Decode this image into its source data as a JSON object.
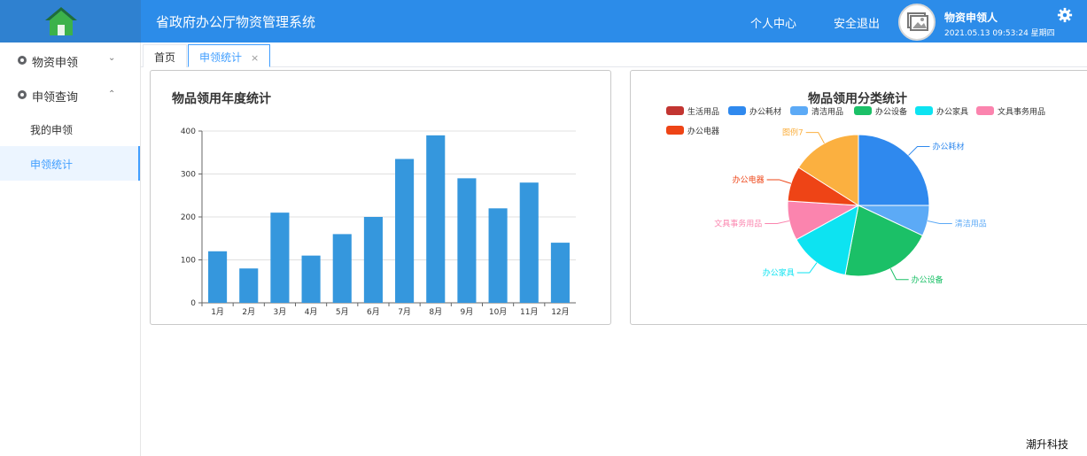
{
  "header": {
    "app_title": "省政府办公厅物资管理系统",
    "personal_center": "个人中心",
    "logout": "安全退出",
    "user_name": "物资申领人",
    "datetime": "2021.05.13 09:53:24 星期四",
    "bg_color": "#2c8ce9",
    "logo_icon": "home-icon",
    "settings_icon": "gear-icon"
  },
  "sidebar": {
    "items": [
      {
        "label": "物资申领",
        "icon": "dot-icon",
        "expanded": false
      },
      {
        "label": "申领查询",
        "icon": "dot-icon",
        "expanded": true
      }
    ],
    "sub_items": [
      {
        "label": "我的申领",
        "active": false
      },
      {
        "label": "申领统计",
        "active": true
      }
    ],
    "accent": "#409eff"
  },
  "tabs": [
    {
      "label": "首页",
      "active": false,
      "closable": false
    },
    {
      "label": "申领统计",
      "active": true,
      "closable": true,
      "close_glyph": "×"
    }
  ],
  "chart_data": [
    {
      "type": "bar",
      "title": "物品领用年度统计",
      "categories": [
        "1月",
        "2月",
        "3月",
        "4月",
        "5月",
        "6月",
        "7月",
        "8月",
        "9月",
        "10月",
        "11月",
        "12月"
      ],
      "values": [
        120,
        80,
        210,
        110,
        160,
        200,
        335,
        390,
        290,
        220,
        280,
        140
      ],
      "yticks": [
        0,
        100,
        200,
        300,
        400
      ],
      "ylim": [
        0,
        400
      ],
      "grid": true,
      "color": "#3597dd"
    },
    {
      "type": "pie",
      "title": "物品领用分类统计",
      "legend": [
        "生活用品",
        "办公耗材",
        "清洁用品",
        "办公设备",
        "办公家具",
        "文具事务用品",
        "办公电器"
      ],
      "legend_colors": [
        "#c23531",
        "#2f89ee",
        "#5caaf6",
        "#1bc067",
        "#0de3f1",
        "#fb84ae",
        "#ee4416"
      ],
      "legend_placement": "top",
      "slices": [
        {
          "name": "办公耗材",
          "value": 25,
          "color": "#2f89ee"
        },
        {
          "name": "清洁用品",
          "value": 7,
          "color": "#5caaf6"
        },
        {
          "name": "办公设备",
          "value": 21,
          "color": "#1bc067"
        },
        {
          "name": "办公家具",
          "value": 14,
          "color": "#0de3f1"
        },
        {
          "name": "文具事务用品",
          "value": 9,
          "color": "#fb84ae"
        },
        {
          "name": "办公电器",
          "value": 8,
          "color": "#ee4416"
        },
        {
          "name": "图例7",
          "value": 16,
          "color": "#fbb040"
        }
      ]
    }
  ],
  "footer": {
    "text": "潮升科技"
  }
}
